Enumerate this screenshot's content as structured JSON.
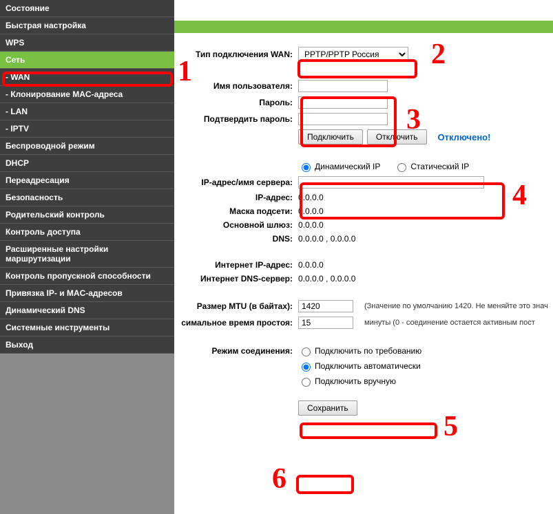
{
  "sidebar": {
    "items": [
      {
        "label": "Состояние",
        "type": "item"
      },
      {
        "label": "Быстрая настройка",
        "type": "item"
      },
      {
        "label": "WPS",
        "type": "item"
      },
      {
        "label": "Сеть",
        "type": "item",
        "active": true
      },
      {
        "label": "- WAN",
        "type": "sub"
      },
      {
        "label": "- Клонирование MAC-адреса",
        "type": "sub"
      },
      {
        "label": "- LAN",
        "type": "sub"
      },
      {
        "label": "- IPTV",
        "type": "sub"
      },
      {
        "label": "Беспроводной режим",
        "type": "item"
      },
      {
        "label": "DHCP",
        "type": "item"
      },
      {
        "label": "Переадресация",
        "type": "item"
      },
      {
        "label": "Безопасность",
        "type": "item"
      },
      {
        "label": "Родительский контроль",
        "type": "item"
      },
      {
        "label": "Контроль доступа",
        "type": "item"
      },
      {
        "label": "Расширенные настройки маршрутизации",
        "type": "item"
      },
      {
        "label": "Контроль пропускной способности",
        "type": "item"
      },
      {
        "label": "Привязка IP- и MAC-адресов",
        "type": "item"
      },
      {
        "label": "Динамический DNS",
        "type": "item"
      },
      {
        "label": "Системные инструменты",
        "type": "item"
      },
      {
        "label": "Выход",
        "type": "item"
      }
    ]
  },
  "labels": {
    "wan_type": "Тип подключения WAN:",
    "username": "Имя пользователя:",
    "password": "Пароль:",
    "confirm_password": "Подтвердить пароль:",
    "server": "IP-адрес/имя сервера:",
    "ip": "IP-адрес:",
    "mask": "Маска подсети:",
    "gateway": "Основной шлюз:",
    "dns": "DNS:",
    "inet_ip": "Интернет IP-адрес:",
    "inet_dns": "Интернет DNS-сервер:",
    "mtu": "Размер MTU (в байтах):",
    "idle": "симальное время простоя:",
    "conn_mode": "Режим соединения:"
  },
  "values": {
    "wan_type_selected": "PPTP/PPTP Россия",
    "username": "",
    "password": "",
    "confirm_password": "",
    "server": "",
    "ip": "0.0.0.0",
    "mask": "0.0.0.0",
    "gateway": "0.0.0.0",
    "dns": "0.0.0.0 , 0.0.0.0",
    "inet_ip": "0.0.0.0",
    "inet_dns": "0.0.0.0 , 0.0.0.0",
    "mtu": "1420",
    "idle": "15"
  },
  "buttons": {
    "connect": "Подключить",
    "disconnect": "Отключить",
    "save": "Сохранить"
  },
  "radios": {
    "dynamic_ip": "Динамический IP",
    "static_ip": "Статический IP",
    "on_demand": "Подключить по требованию",
    "auto": "Подключить автоматически",
    "manual": "Подключить вручную"
  },
  "status": {
    "disconnected": "Отключено!"
  },
  "notes": {
    "mtu": "(Значение по умолчанию 1420. Не меняйте это знач",
    "idle": "минуты (0 - соединение остается активным пост"
  },
  "annotations": {
    "n1": "1",
    "n2": "2",
    "n3": "3",
    "n4": "4",
    "n5": "5",
    "n6": "6"
  }
}
